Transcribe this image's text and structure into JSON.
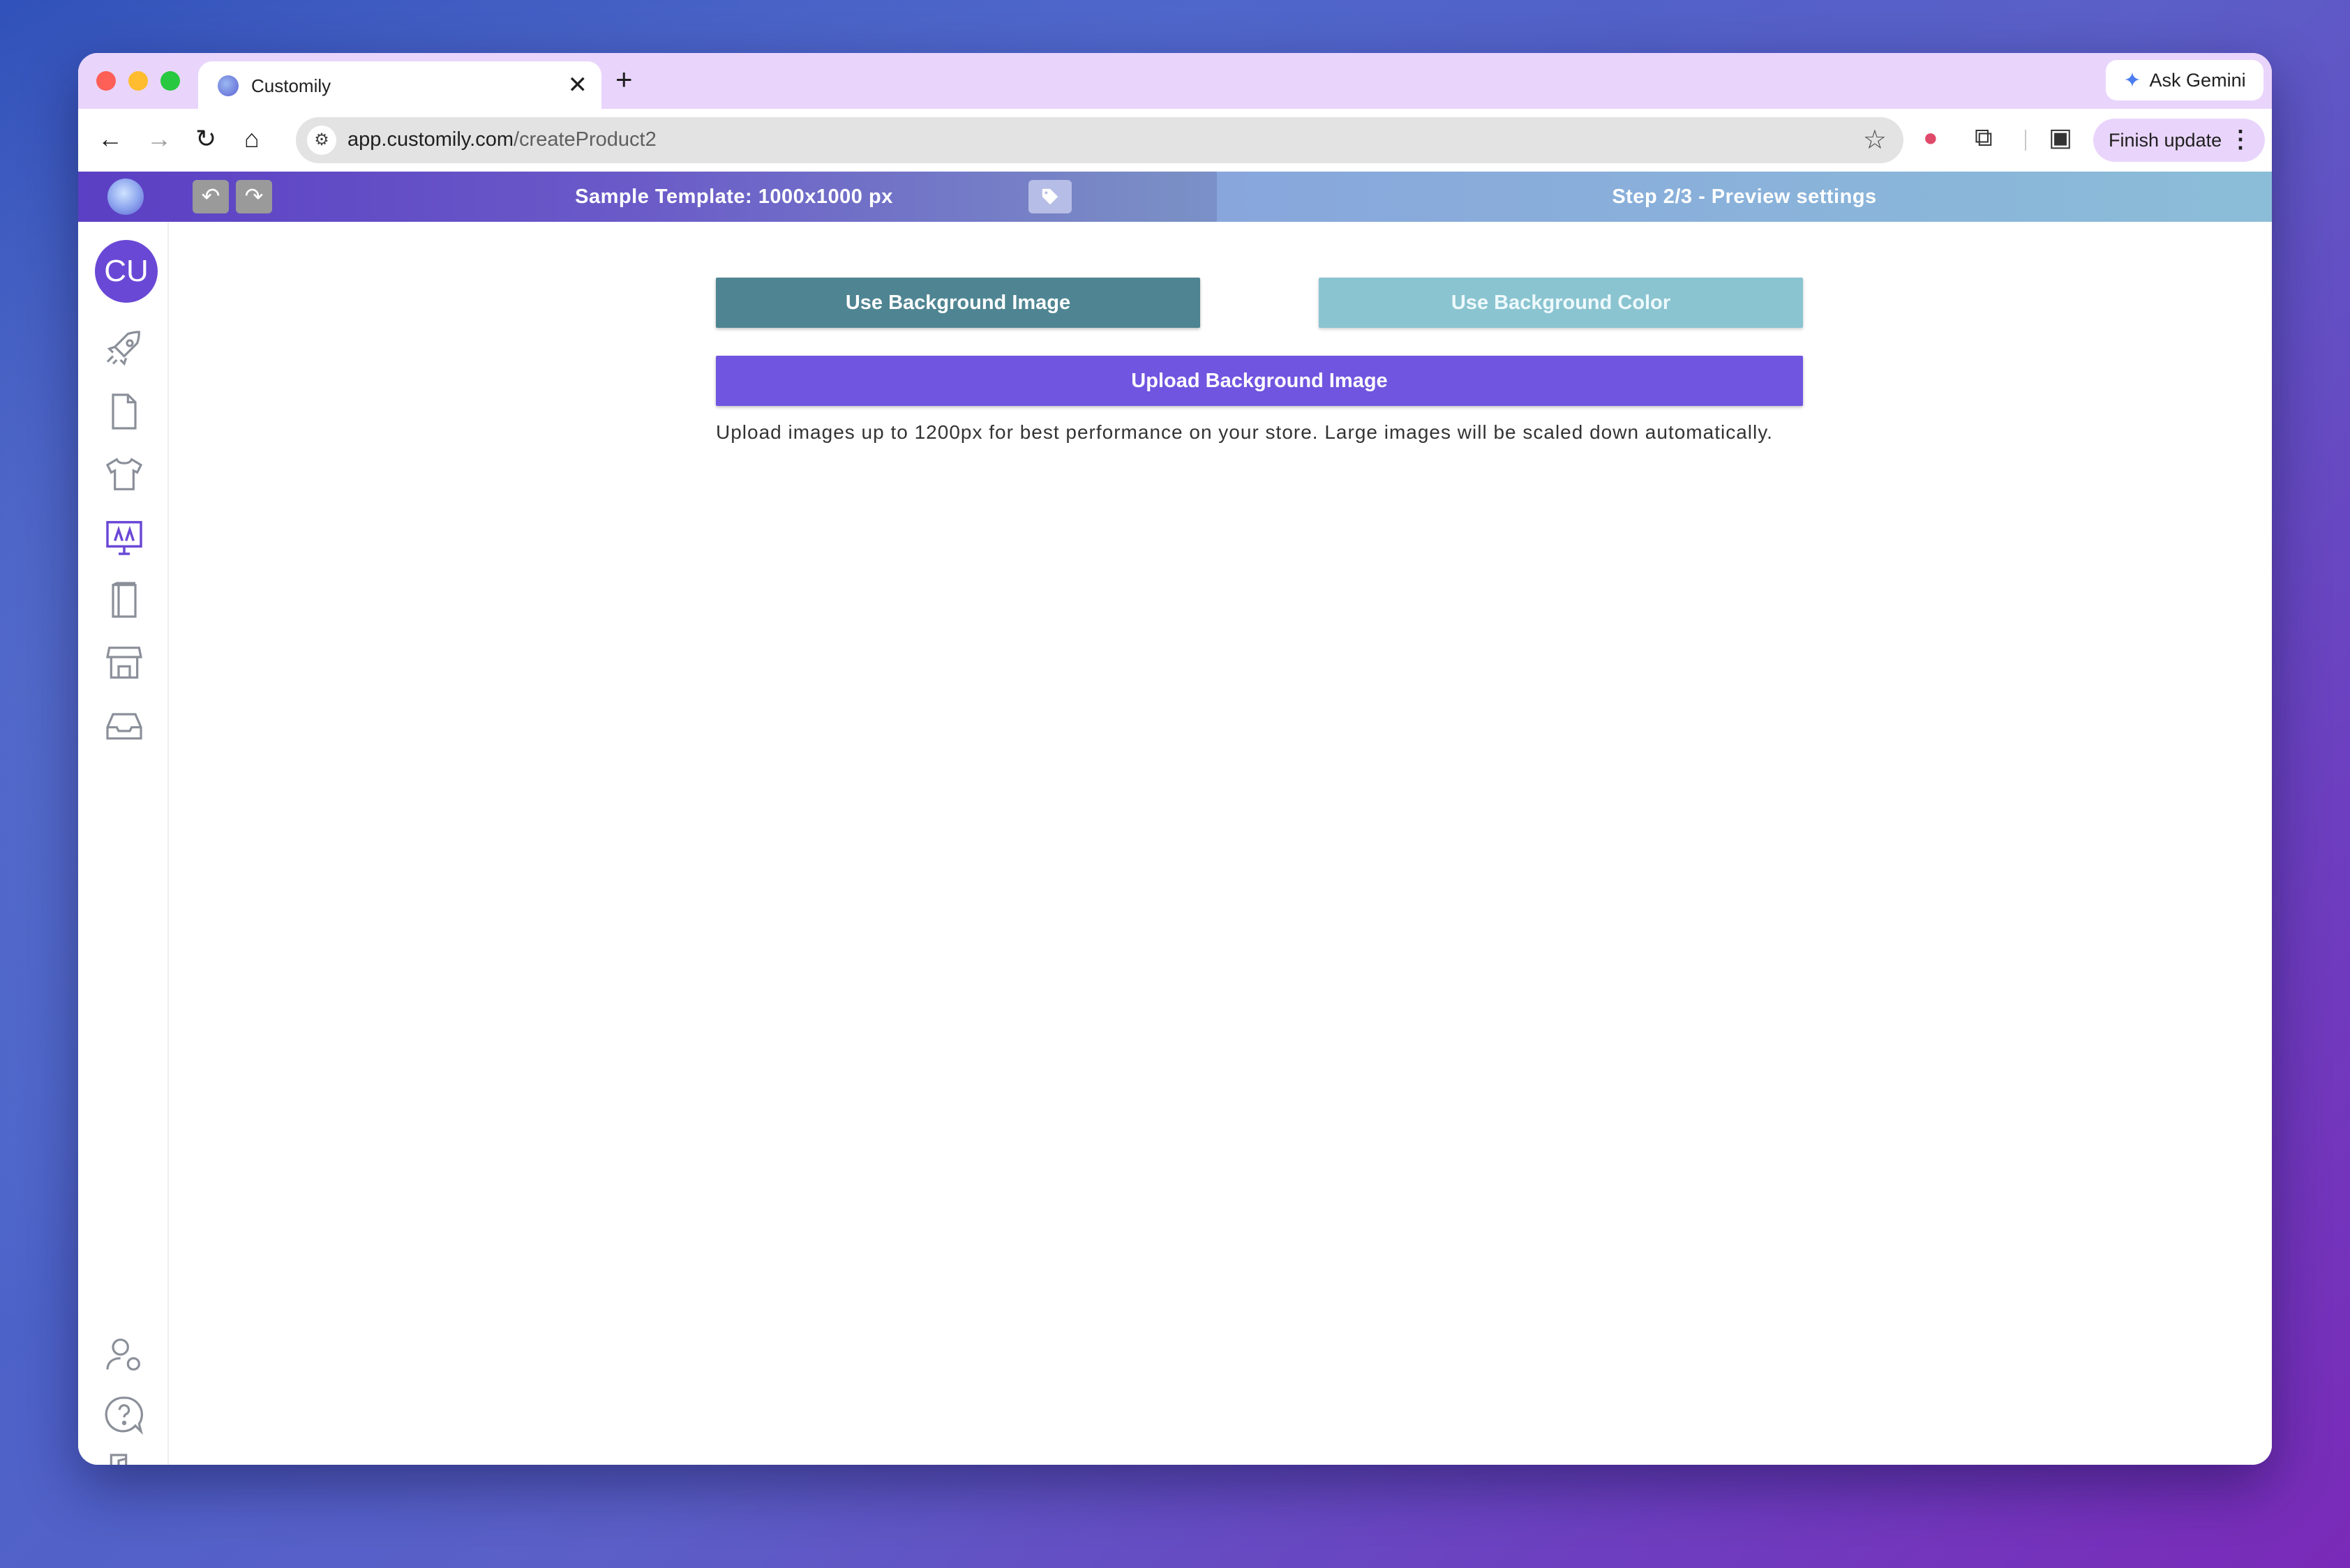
{
  "browser": {
    "tab_title": "Customily",
    "tab_close": "✕",
    "new_tab": "+",
    "ask_gemini": "Ask Gemini",
    "url_host": "app.customily.com",
    "url_path": "/createProduct2",
    "finish_update": "Finish update"
  },
  "header": {
    "template_title": "Sample Template: 1000x1000 px",
    "step_title": "Step 2/3 - Preview settings"
  },
  "sidebar": {
    "user_initials": "CU",
    "icons": [
      "rocket-icon",
      "document-icon",
      "tshirt-icon",
      "monitor-icon",
      "book-icon",
      "store-icon",
      "inbox-icon",
      "user-settings-icon",
      "help-icon",
      "logout-icon"
    ]
  },
  "main": {
    "use_bg_image": "Use Background Image",
    "use_bg_color": "Use Background Color",
    "upload_bg_image": "Upload Background Image",
    "help_text": "Upload images up to 1200px for best performance on your store. Large images will be scaled down automatically."
  },
  "colors": {
    "accent_purple": "#7055e0",
    "teal_dark": "#4f8592",
    "teal_light": "#8ac4d0"
  }
}
